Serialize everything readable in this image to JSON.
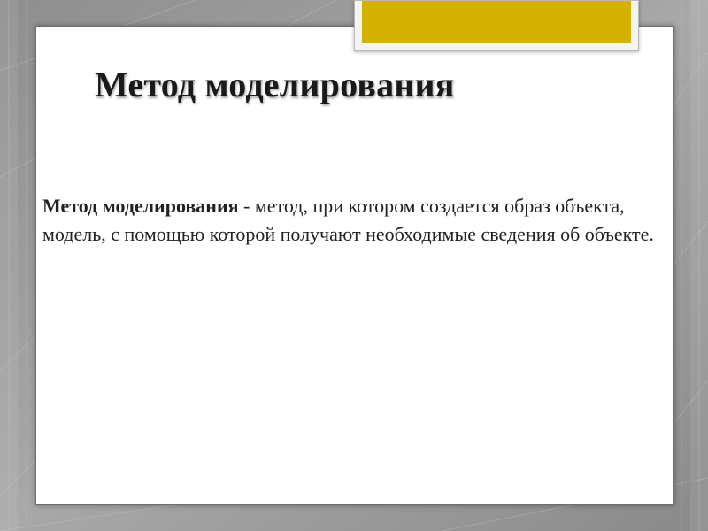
{
  "slide": {
    "title": "Метод моделирования",
    "body": {
      "term": "Метод моделирования",
      "definition": " - метод, при котором создается образ объекта, модель, с помощью которой получают необходимые сведения об объекте."
    }
  },
  "colors": {
    "accent": "#d4b200",
    "background": "#9a9a9a",
    "card": "#ffffff"
  }
}
